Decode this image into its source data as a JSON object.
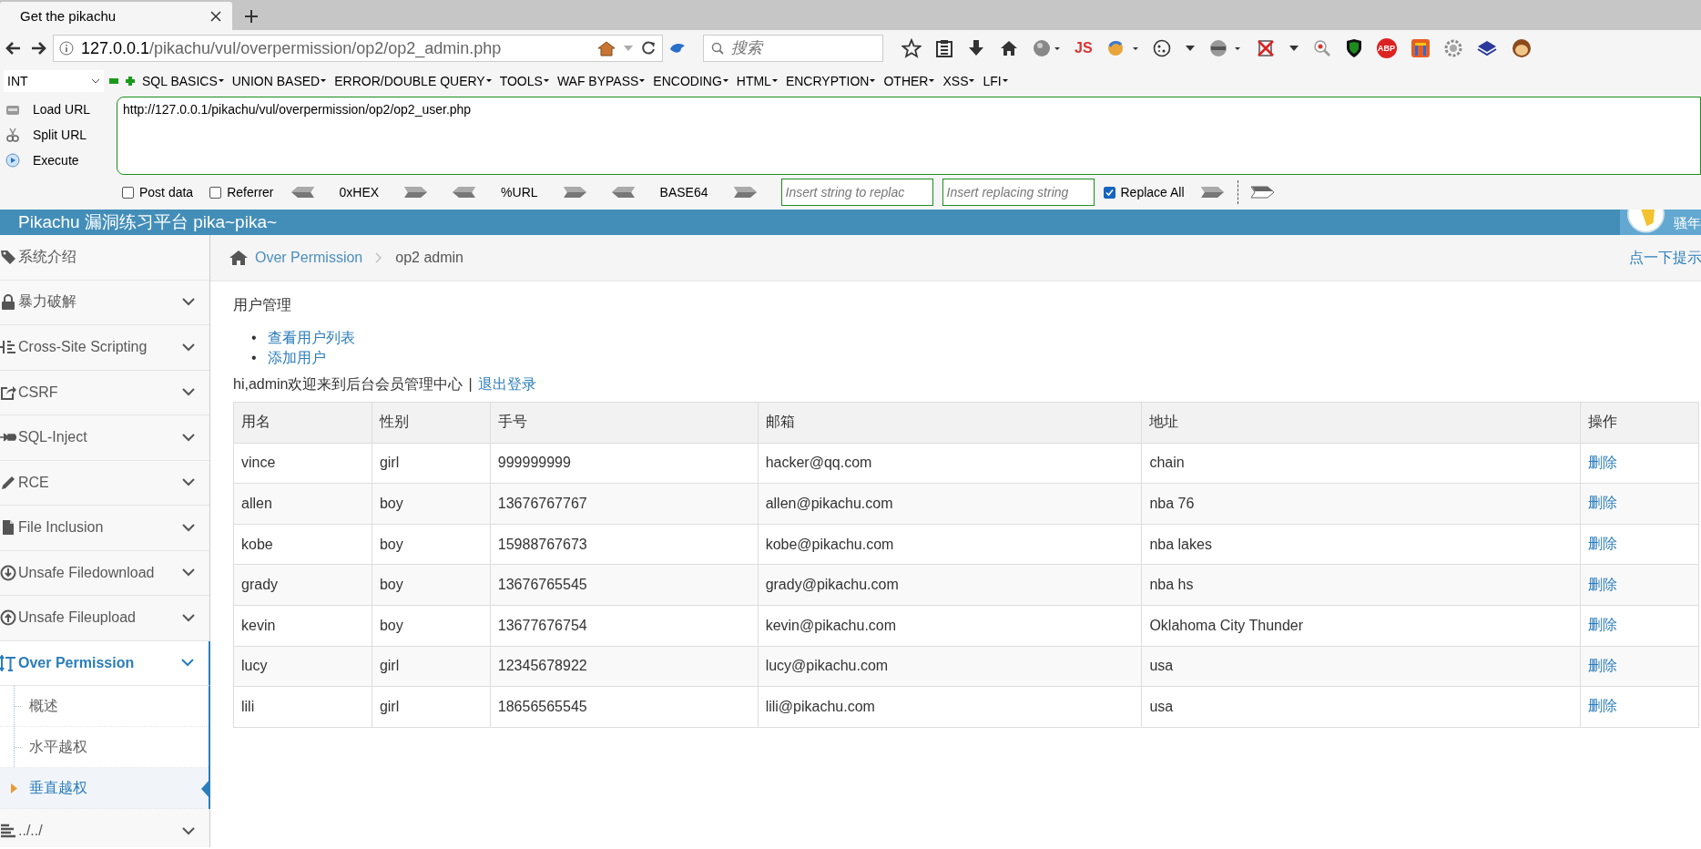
{
  "browser": {
    "tab": {
      "title": "Get the pikachu",
      "selected": true
    },
    "address": {
      "host": "127.0.0.1",
      "path": "/pikachu/vul/overpermission/op2/op2_admin.php"
    },
    "search_placeholder": "搜索",
    "toolbar_labels": {
      "js": "JS",
      "abp": "ABP"
    }
  },
  "hackbar": {
    "mode": "INT",
    "menus": [
      "SQL BASICS",
      "UNION BASED",
      "ERROR/DOUBLE QUERY",
      "TOOLS",
      "WAF BYPASS",
      "ENCODING",
      "HTML",
      "ENCRYPTION",
      "OTHER",
      "XSS",
      "LFI"
    ],
    "actions": [
      "Load URL",
      "Split URL",
      "Execute"
    ],
    "url": "http://127.0.0.1/pikachu/vul/overpermission/op2/op2_user.php",
    "options": [
      {
        "label": "Post data",
        "checked": false
      },
      {
        "label": "Referrer",
        "checked": false
      }
    ],
    "encoders": [
      "0xHEX",
      "%URL",
      "BASE64"
    ],
    "replace_from": {
      "placeholder": "Insert string to replac"
    },
    "replace_to": {
      "placeholder": "Insert replacing string"
    },
    "replace_all": {
      "label": "Replace All",
      "checked": true
    }
  },
  "header": {
    "title": "Pikachu 漏洞练习平台 pika~pika~",
    "user": "骚年"
  },
  "sidebar": {
    "items": [
      {
        "label": "系统介绍",
        "selected": false
      },
      {
        "label": "暴力破解",
        "selected": false
      },
      {
        "label": "Cross-Site Scripting",
        "selected": false
      },
      {
        "label": "CSRF",
        "selected": false
      },
      {
        "label": "SQL-Inject",
        "selected": false
      },
      {
        "label": "RCE",
        "selected": false
      },
      {
        "label": "File Inclusion",
        "selected": false
      },
      {
        "label": "Unsafe Filedownload",
        "selected": false
      },
      {
        "label": "Unsafe Fileupload",
        "selected": false
      },
      {
        "label": "Over Permission",
        "expanded": true,
        "selected": true,
        "children": [
          {
            "label": "概述",
            "selected": false
          },
          {
            "label": "水平越权",
            "selected": false
          },
          {
            "label": "垂直越权",
            "selected": true
          }
        ]
      },
      {
        "label": "../../",
        "selected": false
      }
    ]
  },
  "breadcrumb": {
    "parent": "Over Permission",
    "current": "op2 admin",
    "hint": "点一下提示"
  },
  "content": {
    "heading": "用户管理",
    "links": [
      {
        "marker": "•",
        "label": "查看用户列表"
      },
      {
        "marker": "•",
        "label": "添加用户"
      }
    ],
    "welcome": "hi,admin欢迎来到后台会员管理中心",
    "separator": "|",
    "logout": "退出登录"
  },
  "table": {
    "columns": [
      "用名",
      "性别",
      "手号",
      "邮箱",
      "地址",
      "操作"
    ],
    "rows": [
      {
        "cells": [
          "vince",
          "girl",
          "999999999",
          "hacker@qq.com",
          "chain"
        ],
        "action": "删除"
      },
      {
        "cells": [
          "allen",
          "boy",
          "13676767767",
          "allen@pikachu.com",
          "nba 76"
        ],
        "action": "删除"
      },
      {
        "cells": [
          "kobe",
          "boy",
          "15988767673",
          "kobe@pikachu.com",
          "nba lakes"
        ],
        "action": "删除"
      },
      {
        "cells": [
          "grady",
          "boy",
          "13676765545",
          "grady@pikachu.com",
          "nba hs"
        ],
        "action": "删除"
      },
      {
        "cells": [
          "kevin",
          "boy",
          "13677676754",
          "kevin@pikachu.com",
          "Oklahoma City Thunder"
        ],
        "action": "删除"
      },
      {
        "cells": [
          "lucy",
          "girl",
          "12345678922",
          "lucy@pikachu.com",
          "usa"
        ],
        "action": "删除"
      },
      {
        "cells": [
          "lili",
          "girl",
          "18656565545",
          "lili@pikachu.com",
          "usa"
        ],
        "action": "删除"
      }
    ]
  }
}
